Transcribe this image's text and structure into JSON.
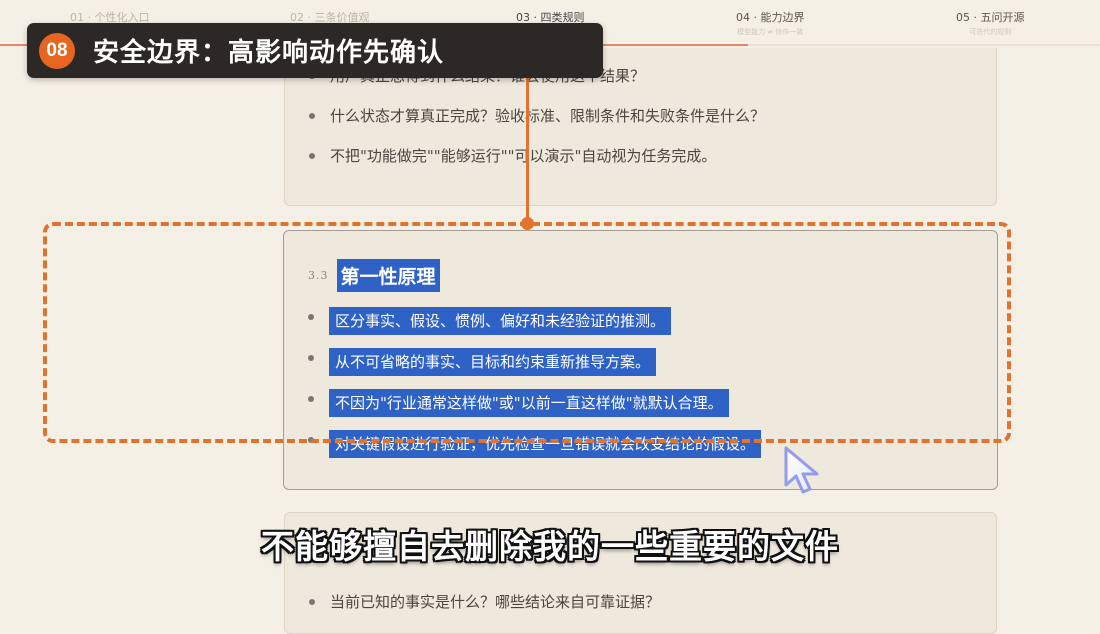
{
  "stepper": {
    "steps": [
      {
        "title": "01 · 个性化入口",
        "sub": ""
      },
      {
        "title": "02 · 三条价值观",
        "sub": ""
      },
      {
        "title": "03 · 四类规则",
        "sub": ""
      },
      {
        "title": "04 · 能力边界",
        "sub": "模型能力 ≠ 协作一致"
      },
      {
        "title": "05 · 五问开源",
        "sub": "可迭代的规则"
      }
    ],
    "active_index": 2,
    "progress": 0.68
  },
  "banner": {
    "number": "08",
    "title": "安全边界：高影响动作先确认"
  },
  "top_card": {
    "items": [
      "用户真正想得到什么结果？谁会使用这个结果？",
      "什么状态才算真正完成？验收标准、限制条件和失败条件是什么？",
      "不把\"功能做完\"\"能够运行\"\"可以演示\"自动视为任务完成。"
    ]
  },
  "section": {
    "number": "3.3",
    "title": "第一性原理",
    "items": [
      "区分事实、假设、惯例、偏好和未经验证的推测。",
      "从不可省略的事实、目标和约束重新推导方案。",
      "不因为\"行业通常这样做\"或\"以前一直这样做\"就默认合理。",
      "对关键假设进行验证，优先检查一旦错误就会改变结论的假设。"
    ]
  },
  "bottom_card": {
    "items": [
      "当前已知的事实是什么？哪些结论来自可靠证据？"
    ]
  },
  "subtitle": "不能够擅自去删除我的一些重要的文件",
  "colors": {
    "accent": "#e0742e",
    "highlight": "#2f62c7",
    "badge": "#e8651f",
    "banner_bg": "#2b2825",
    "page_bg": "#f5f0e6"
  }
}
